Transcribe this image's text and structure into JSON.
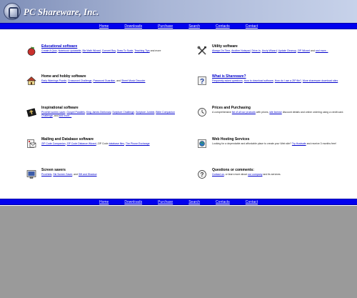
{
  "header": {
    "logo_text": "PC Shareware, Inc."
  },
  "nav": {
    "items": [
      "Home",
      "Downloads",
      "Purchase",
      "Search",
      "Contacts",
      "Contact"
    ]
  },
  "sections_left": [
    {
      "title": "Educational software",
      "desc_links": [
        "Create A Quiz",
        "Notebook Updatable",
        "Biz Math Wizard",
        "Convert Boy",
        "Draw To Scale",
        "Teaching Tips"
      ],
      "desc_tail": "and more"
    },
    {
      "title": "Home and hobby software",
      "desc_links": [
        "Early Warnings Puzzle",
        "Crossword Challenge",
        "Password Guardian",
        "Sheet Music Decoder"
      ],
      "desc_tail": ""
    },
    {
      "title": "Inspirational software",
      "desc_links": [
        "ProvNet screen saver",
        "Gospel Parallels",
        "King James Dictionary",
        "Scripture Challenge",
        "Scripture Jumble",
        "Bible Companion Challenge"
      ],
      "desc_tail": "and more..."
    },
    {
      "title": "Mailing and Database software",
      "desc_links": [
        "ZIP Code Companion",
        "ZIP Code Distance Wizard"
      ],
      "desc_mid": ", ZIP Code",
      "desc_links2": [
        "database files",
        "The Phone Exchange"
      ],
      "desc_tail": ""
    },
    {
      "title": "Screen savers",
      "desc_links": [
        "ProvNets",
        "Ski Screen Saver"
      ],
      "desc_mid": ", and",
      "desc_links2": [
        "Sift and Shadow"
      ],
      "desc_tail": ""
    }
  ],
  "sections_right": [
    {
      "title": "Utility software",
      "desc_links": [
        "Always On Time",
        "Another Notepad",
        "Drive-In",
        "Unzip Wizard",
        "Update Cleanup",
        "ZIP Wizard"
      ],
      "desc_tail": "and more..."
    },
    {
      "title": "What is Shareware?",
      "desc_links": [
        "Frequently asked questions",
        "How to download software",
        "How do I use a ZIP file?",
        "More shareware download sites"
      ],
      "desc_tail": ""
    },
    {
      "title": "Prices and Purchasing",
      "desc_pre": "A comprehensive",
      "desc_links": [
        "list of all our products"
      ],
      "desc_mid": "with prices,",
      "desc_links2": [
        "site license"
      ],
      "desc_tail": "discount details and online ordering using a credit card."
    },
    {
      "title": "Web Hosting Services",
      "desc_pre": "Looking for a dependable and affordable place to create your Web site?",
      "desc_links": [
        "Try Hostsafe"
      ],
      "desc_tail": "and receive 3 months free!"
    },
    {
      "title": "Questions or comments:",
      "desc_links": [
        "Contact us"
      ],
      "desc_mid": ", or learn more about",
      "desc_links2": [
        "our company"
      ],
      "desc_tail": "and its services."
    }
  ],
  "colors": {
    "nav_bar": "#0000ee",
    "link": "#0000cc",
    "background": "#9a9a9a"
  },
  "icons": [
    "apple-icon",
    "house-icon",
    "book-cross-icon",
    "envelope-icon",
    "monitor-icon",
    "tools-icon",
    "question-icon",
    "dollar-icon",
    "globe-icon",
    "question-mark-icon"
  ]
}
